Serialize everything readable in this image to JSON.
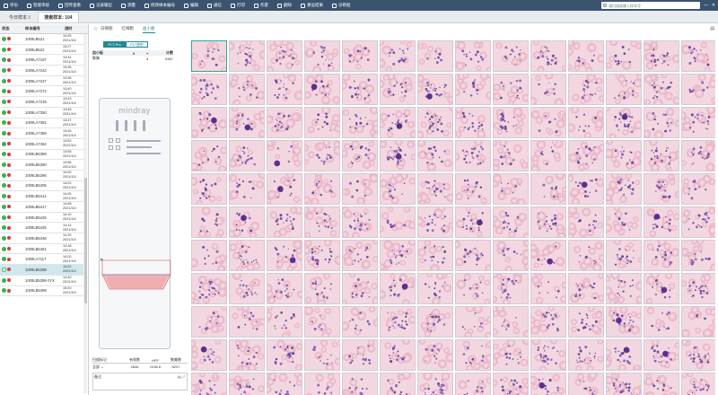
{
  "toolbar": {
    "items": [
      {
        "label": "单份",
        "icon": "sample-icon"
      },
      {
        "label": "智能审核",
        "icon": "audit-icon"
      },
      {
        "label": "回传查看",
        "icon": "return-icon"
      },
      {
        "label": "记录输出",
        "icon": "record-icon"
      },
      {
        "label": "测量",
        "icon": "measure-icon"
      },
      {
        "label": "修改样本编号",
        "icon": "edit-icon"
      },
      {
        "label": "编辑",
        "icon": "pencil-icon"
      },
      {
        "label": "通信",
        "icon": "comm-icon"
      },
      {
        "label": "打印",
        "icon": "print-icon"
      },
      {
        "label": "作废",
        "icon": "undo-icon"
      },
      {
        "label": "删除",
        "icon": "delete-icon"
      },
      {
        "label": "重设结果",
        "icon": "reset-icon"
      },
      {
        "label": "诊断框",
        "icon": "dialog-icon"
      }
    ],
    "search_placeholder": "请扫描或输入样本号"
  },
  "tabs": [
    {
      "label": "今日样本",
      "count": "8"
    },
    {
      "label": "搜索样本: 104"
    }
  ],
  "sample_list": {
    "headers": [
      "状态",
      "样本编号",
      "测时"
    ],
    "rows": [
      {
        "id": "1009LB521",
        "time": "13:25",
        "date": "2021/10/",
        "s": "gr"
      },
      {
        "id": "1009LB522",
        "time": "13:27",
        "date": "2021/10/",
        "s": "gr"
      },
      {
        "id": "1009LA7187",
        "time": "13:32",
        "date": "2021/10/",
        "s": "gr"
      },
      {
        "id": "1009LA7243",
        "time": "13:35",
        "date": "2021/10/",
        "s": "gr"
      },
      {
        "id": "1009LA7247",
        "time": "13:38",
        "date": "2021/10/",
        "s": "gr"
      },
      {
        "id": "1009LA7274",
        "time": "13:40",
        "date": "2021/10/",
        "s": "gr"
      },
      {
        "id": "1009LA7319",
        "time": "13:43",
        "date": "2021/10/",
        "s": "gr"
      },
      {
        "id": "1009LA7350",
        "time": "13:45",
        "date": "2021/10/",
        "s": "gr"
      },
      {
        "id": "1009LA7381",
        "time": "13:47",
        "date": "2021/10/",
        "s": "gr"
      },
      {
        "id": "1009LA7389",
        "time": "13:49",
        "date": "2021/10/",
        "s": "gr"
      },
      {
        "id": "1009LA7464",
        "time": "13:52",
        "date": "2021/10/",
        "s": "gr"
      },
      {
        "id": "1009LB5389",
        "time": "13:55",
        "date": "2021/10/",
        "s": "gr"
      },
      {
        "id": "1009LB5390",
        "time": "13:58",
        "date": "2021/10/",
        "s": "gr"
      },
      {
        "id": "1009LB5396",
        "time": "14:00",
        "date": "2021/10/",
        "s": "gr"
      },
      {
        "id": "1009LB5405",
        "time": "14:02",
        "date": "2021/10/",
        "s": "gr"
      },
      {
        "id": "1009LB5414",
        "time": "14:05",
        "date": "2021/10/",
        "s": "gr"
      },
      {
        "id": "1009LB5417",
        "time": "14:08",
        "date": "2021/10/",
        "s": "gr"
      },
      {
        "id": "1009LB5425",
        "time": "14:10",
        "date": "2021/10/",
        "s": "gr"
      },
      {
        "id": "1009LB5426",
        "time": "14:12",
        "date": "2021/10/",
        "s": "gr"
      },
      {
        "id": "1009LB5448",
        "time": "14:15",
        "date": "2021/10/",
        "s": "gr"
      },
      {
        "id": "1009LB5451",
        "time": "14:18",
        "date": "2021/10/",
        "s": "gr"
      },
      {
        "id": "1009LA7117",
        "time": "14:20",
        "date": "2021/10/",
        "s": "gr"
      },
      {
        "id": "1009LB5398",
        "time": "14:22",
        "date": "2021/10/",
        "s": "w"
      },
      {
        "id": "1009LB5398-JYX",
        "time": "14:40",
        "date": "2021/10/",
        "s": "gr"
      },
      {
        "id": "1009LB5499",
        "time": "15:20",
        "date": "2021/10/",
        "s": "gr"
      }
    ],
    "selected_index": 22
  },
  "view_tabs": [
    "白细胞",
    "红细胞",
    "血小板"
  ],
  "active_view_tab": 2,
  "segments": [
    "PLT-Pro",
    "PLT放射"
  ],
  "count_table": {
    "headers": [
      "血小板",
      "0",
      "+",
      "计数"
    ],
    "row": {
      "name": "聚集",
      "value": "8367"
    }
  },
  "slide": {
    "brand": "mindray"
  },
  "summary": {
    "headers": [
      "扫描标记",
      "有效数",
      "HPF",
      "聚集数"
    ],
    "row": {
      "label": "全部",
      "valid": "2646",
      "hpf": "1436.6",
      "agg": "8207"
    }
  },
  "note_label": "备注",
  "colors": {
    "toolbar": "#3a5470",
    "accent": "#1e8a93",
    "cell_bg": "#f3d7e0",
    "status_green": "#38b44a",
    "status_red": "#d83a3a"
  }
}
